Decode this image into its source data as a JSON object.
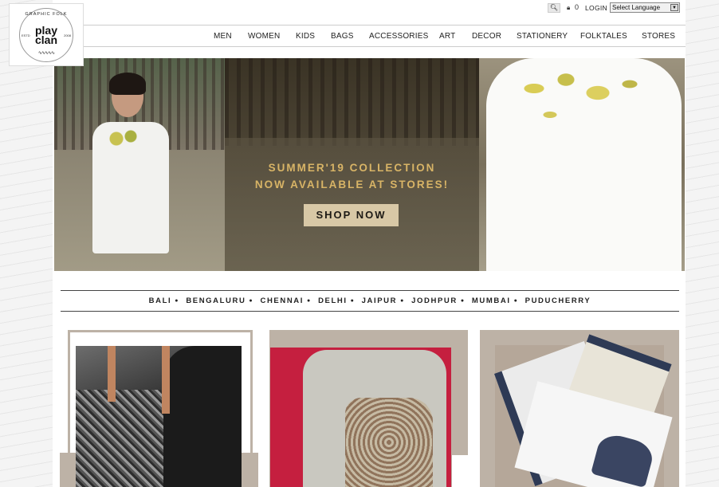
{
  "logo": {
    "arc_text": "GRAPHIC FOLK",
    "name_line1": "play",
    "name_line2": "clan",
    "est": "ESTD",
    "year": "2008"
  },
  "topbar": {
    "cart_count": "0",
    "login_label": "LOGIN",
    "language_select": "Select Language"
  },
  "nav": {
    "items": [
      "MEN",
      "WOMEN",
      "KIDS",
      "BAGS",
      "ACCESSORIES",
      "ART",
      "DECOR",
      "STATIONERY",
      "FOLKTALES",
      "STORES"
    ]
  },
  "hero": {
    "title_line1": "SUMMER'19 COLLECTION",
    "title_line2": "NOW AVAILABLE AT STORES!",
    "cta_label": "SHOP NOW"
  },
  "cities": [
    "BALI",
    "BENGALURU",
    "CHENNAI",
    "DELHI",
    "JAIPUR",
    "JODHPUR",
    "MUMBAI",
    "PUDUCHERRY"
  ],
  "colors": {
    "gold": "#d8b466",
    "cta_bg": "#d8c8a6",
    "card_frame": "#bdb2a6",
    "tee_bg": "#c51f3f"
  }
}
